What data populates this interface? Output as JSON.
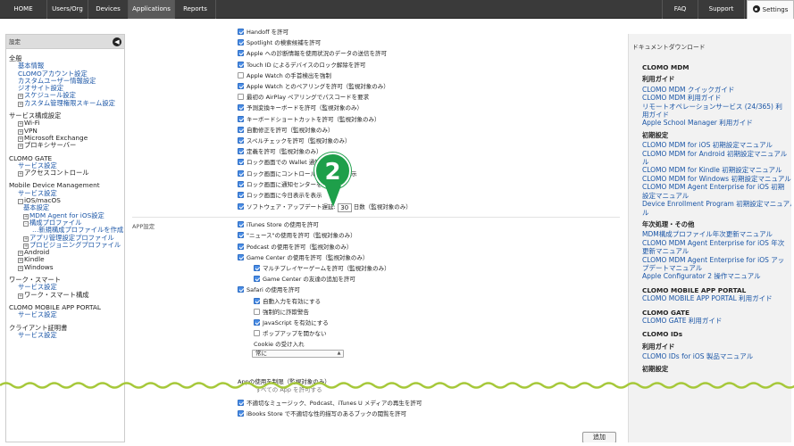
{
  "topnav": {
    "items": [
      {
        "label": "HOME"
      },
      {
        "label": "Users/Org"
      },
      {
        "label": "Devices"
      },
      {
        "label": "Applications"
      },
      {
        "label": "Reports"
      },
      {
        "label": "FAQ"
      },
      {
        "label": "Support"
      },
      {
        "label": "Settings"
      }
    ]
  },
  "sidebar": {
    "header": "設定",
    "close_icon": "◀",
    "lines": [
      {
        "kind": "sec",
        "text": "全般"
      },
      {
        "kind": "link",
        "text": "基本情報"
      },
      {
        "kind": "link",
        "text": "CLOMOアカウント設定"
      },
      {
        "kind": "link",
        "text": "カスタムユーザー情報設定"
      },
      {
        "kind": "link",
        "text": "ジオサイト設定"
      },
      {
        "kind": "link",
        "tog": "+",
        "text": "スケジュール設定"
      },
      {
        "kind": "link",
        "tog": "+",
        "text": "カスタム管理権限スキーム設定"
      },
      {
        "kind": "sec",
        "text": "サービス構成設定"
      },
      {
        "kind": "text",
        "tog": "+",
        "text": "Wi-Fi"
      },
      {
        "kind": "text",
        "tog": "+",
        "text": "VPN"
      },
      {
        "kind": "text",
        "tog": "+",
        "text": "Microsoft Exchange"
      },
      {
        "kind": "text",
        "tog": "+",
        "text": "プロキシサーバー"
      },
      {
        "kind": "sec",
        "text": "CLOMO GATE"
      },
      {
        "kind": "link",
        "text": "サービス設定"
      },
      {
        "kind": "text",
        "tog": "+",
        "text": "アクセスコントロール"
      },
      {
        "kind": "sec",
        "text": "Mobile Device Management"
      },
      {
        "kind": "link",
        "text": "サービス設定"
      },
      {
        "kind": "text",
        "tog": "-",
        "text": "iOS/macOS"
      },
      {
        "kind": "sub",
        "text": "基本設定"
      },
      {
        "kind": "sub",
        "tog": "+",
        "text": "MDM Agent for iOS設定"
      },
      {
        "kind": "sub",
        "tog": "-",
        "text": "構成プロファイル"
      },
      {
        "kind": "sub3",
        "text": "…新規構成プロファイルを作成"
      },
      {
        "kind": "sub",
        "tog": "+",
        "text": "アプリ管理設定プロファイル"
      },
      {
        "kind": "sub",
        "tog": "+",
        "text": "プロビジョニングプロファイル"
      },
      {
        "kind": "text",
        "tog": "+",
        "text": "Android"
      },
      {
        "kind": "text",
        "tog": "+",
        "text": "Kindle"
      },
      {
        "kind": "text",
        "tog": "+",
        "text": "Windows"
      },
      {
        "kind": "sec",
        "text": "ワーク・スマート"
      },
      {
        "kind": "link",
        "text": "サービス設定"
      },
      {
        "kind": "text",
        "tog": "+",
        "text": "ワーク・スマート構成"
      },
      {
        "kind": "sec",
        "text": "CLOMO MOBILE APP PORTAL"
      },
      {
        "kind": "link",
        "text": "サービス設定"
      },
      {
        "kind": "sec",
        "text": "クライアント証明書"
      },
      {
        "kind": "link",
        "text": "サービス設定"
      }
    ]
  },
  "main": {
    "restrictions": [
      {
        "text": "Handoff を許可",
        "checked": true
      },
      {
        "text": "Spotlight の検索候補を許可",
        "checked": true
      },
      {
        "text": "Apple への診断情報を使用状況のデータの送信を許可",
        "checked": true
      },
      {
        "text": "Touch ID によるデバイスのロック解除を許可",
        "checked": true
      },
      {
        "text": "Apple Watch の手首検出を強制",
        "checked": false
      },
      {
        "text": "Apple Watch とのペアリングを許可（監視対象のみ）",
        "checked": true
      },
      {
        "text": "最初の AirPlay ペアリングでパスコードを要求",
        "checked": false
      },
      {
        "text": "予測変換キーボードを許可（監視対象のみ）",
        "checked": true
      },
      {
        "text": "キーボードショートカットを許可（監視対象のみ）",
        "checked": true
      },
      {
        "text": "自動修正を許可（監視対象のみ）",
        "checked": true
      },
      {
        "text": "スペルチェックを許可（監視対象のみ）",
        "checked": true
      },
      {
        "text": "定義を許可（監視対象のみ）",
        "checked": true
      },
      {
        "text": "ロック画面での Wallet 通知を許可",
        "checked": true
      },
      {
        "text": "ロック画面にコントロールセンターを表示",
        "checked": true
      },
      {
        "text": "ロック画面に通知センターを表示",
        "checked": true
      },
      {
        "text": "ロック画面に今日表示を表示",
        "checked": true
      }
    ],
    "software_update": {
      "prefix": "ソフトウェア・アップデート遅延:",
      "value": "30",
      "suffix": "日数（監視対象のみ）",
      "checked": true
    },
    "app_group_label": "APP設定",
    "app_items": [
      {
        "text": "iTunes Store の使用を許可",
        "checked": true,
        "indent": 0
      },
      {
        "text": "\"ニュース\"の使用を許可（監視対象のみ）",
        "checked": true,
        "indent": 0
      },
      {
        "text": "Podcast の使用を許可（監視対象のみ）",
        "checked": true,
        "indent": 0
      },
      {
        "text": "Game Center の使用を許可（監視対象のみ）",
        "checked": true,
        "indent": 0
      },
      {
        "text": "マルチプレイヤーゲームを許可（監視対象のみ）",
        "checked": true,
        "indent": 1
      },
      {
        "text": "Game Center の友達の追加を許可",
        "checked": true,
        "indent": 1
      },
      {
        "text": "Safari の使用を許可",
        "checked": true,
        "indent": 0
      },
      {
        "text": "自動入力を有効にする",
        "checked": true,
        "indent": 1
      },
      {
        "text": "強制的に詐欺警告",
        "checked": false,
        "indent": 1
      },
      {
        "text": "JavaScript を有効にする",
        "checked": true,
        "indent": 1
      },
      {
        "text": "ポップアップを開かない",
        "checked": false,
        "indent": 1
      }
    ],
    "cookie_label": "Cookie の受け入れ",
    "cookie_value": "常に",
    "app_usage_label": "Appの使用を制限（監視対象のみ）",
    "app_usage_partial": "すべての App を許可する",
    "bottom_items": [
      {
        "text": "不適切なミュージック、Podcast、iTunes U メディアの再生を許可",
        "checked": true
      },
      {
        "text": "iBooks Store で不適切な性的描写のあるブックの閲覧を許可",
        "checked": true
      }
    ],
    "add_button": "追加",
    "step_badge": "2"
  },
  "right": {
    "title": "ドキュメントダウンロード",
    "sections": [
      {
        "heading": "CLOMO MDM",
        "big": true
      },
      {
        "heading": "利用ガイド",
        "sub": true
      },
      {
        "link": "CLOMO MDM クイックガイド"
      },
      {
        "link": "CLOMO MDM 利用ガイド"
      },
      {
        "link": "リモートオペレーションサービス (24/365) 利"
      },
      {
        "link": "用ガイド"
      },
      {
        "link": "Apple School Manager 利用ガイド"
      },
      {
        "heading": "初期設定",
        "sub": true
      },
      {
        "link": "CLOMO MDM for iOS 初期設定マニュアル"
      },
      {
        "link": "CLOMO MDM for Android 初期設定マニュアル"
      },
      {
        "link": "ル"
      },
      {
        "link": "CLOMO MDM for Kindle 初期設定マニュアル"
      },
      {
        "link": "CLOMO MDM for Windows 初期設定マニュアル"
      },
      {
        "link": "CLOMO MDM Agent Enterprise for iOS 初期"
      },
      {
        "link": "設定マニュアル"
      },
      {
        "link": "Device Enrollment Program 初期設定マニュアル"
      },
      {
        "link": "ル"
      },
      {
        "heading": "年次処理・その他",
        "sub": true
      },
      {
        "link": "MDM構成プロファイル年次更新マニュアル"
      },
      {
        "link": "CLOMO MDM Agent Enterprise for iOS 年次"
      },
      {
        "link": "更新マニュアル"
      },
      {
        "link": "CLOMO MDM Agent Enterprise for iOS アッ"
      },
      {
        "link": "プデートマニュアル"
      },
      {
        "link": "Apple Configurator 2 操作マニュアル"
      },
      {
        "heading": "CLOMO MOBILE APP PORTAL",
        "big": true
      },
      {
        "link": "CLOMO MOBILE APP PORTAL 利用ガイド"
      },
      {
        "heading": "CLOMO GATE",
        "big": true
      },
      {
        "link": "CLOMO GATE 利用ガイド"
      },
      {
        "heading": "CLOMO IDs",
        "big": true
      },
      {
        "heading": "利用ガイド",
        "sub": true
      },
      {
        "link": "CLOMO IDs for iOS 製品マニュアル"
      },
      {
        "heading": "初期設定",
        "sub": true
      }
    ]
  }
}
